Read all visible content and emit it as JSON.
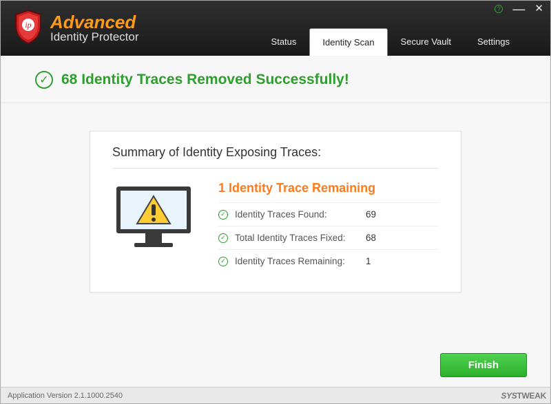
{
  "brand": {
    "line1": "Advanced",
    "line2": "Identity Protector"
  },
  "window_controls": {
    "help": "?",
    "minimize": "—",
    "close": "✕"
  },
  "tabs": [
    {
      "label": "Status"
    },
    {
      "label": "Identity Scan"
    },
    {
      "label": "Secure Vault"
    },
    {
      "label": "Settings"
    }
  ],
  "active_tab_index": 1,
  "banner": {
    "text": "68 Identity Traces Removed Successfully!"
  },
  "summary": {
    "title": "Summary of Identity Exposing Traces:",
    "remaining_title": "1 Identity Trace Remaining",
    "rows": [
      {
        "label": "Identity Traces Found:",
        "value": "69"
      },
      {
        "label": "Total Identity Traces Fixed:",
        "value": "68"
      },
      {
        "label": "Identity Traces Remaining:",
        "value": "1"
      }
    ]
  },
  "actions": {
    "finish": "Finish"
  },
  "footer": {
    "version": "Application Version 2.1.1000.2540",
    "vendor": "SYSTWEAK"
  }
}
